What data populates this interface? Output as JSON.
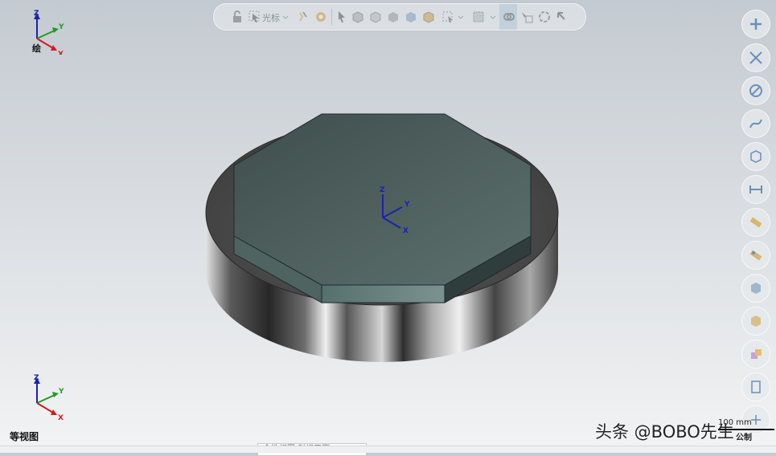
{
  "toolbar": {
    "cursor_label": "光标",
    "icons": [
      "lock-icon",
      "select-cursor-icon",
      "light-icon",
      "gear-icon",
      "pointer-icon",
      "cube-wire-icon",
      "cube-shaded-icon",
      "cube-solid-icon",
      "cube-orange-icon",
      "box-select-icon",
      "grid-icon",
      "link-icon",
      "check-select-icon",
      "rotate-icon",
      "arrow-return-icon"
    ]
  },
  "viewport": {
    "top_triad_label": "绘",
    "view_name": "等视图",
    "axes": {
      "x": "X",
      "y": "Y",
      "z": "Z"
    }
  },
  "right_panel": {
    "buttons": [
      "plus-icon",
      "cross-hatch-icon",
      "circle-slash-icon",
      "curve-icon",
      "cube-view-icon",
      "dimension-icon",
      "ruler-icon",
      "ruler-alt-icon",
      "iso-cube-icon",
      "shaded-cube-icon",
      "color-cube-icon",
      "layers-icon",
      "expand-icon"
    ]
  },
  "status": {
    "tip_text": "全性视图   剖视平面",
    "scale_text": "100 mm",
    "units": "公制"
  },
  "watermark": "头条 @BOBO先生",
  "colors": {
    "octagon_top": "#4a5b59",
    "octagon_side": "#6a7e7d",
    "disk_top": "#4a4a4a",
    "axis_x": "#d01c1c",
    "axis_y": "#1f9c22",
    "axis_z": "#1b23a8"
  }
}
